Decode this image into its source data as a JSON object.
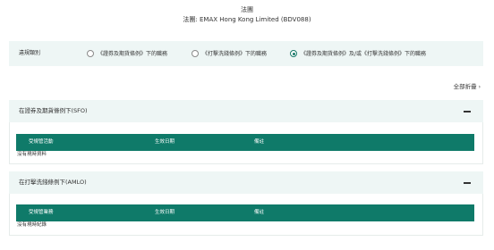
{
  "header": {
    "title": "法團",
    "subtitle": "法團: EMAX Hong Kong Limited (BDV088)"
  },
  "filter": {
    "label": "違規類別",
    "options": [
      {
        "label": "《證券及期貨條例》下的職務",
        "selected": false
      },
      {
        "label": "《打擊洗錢條例》下的職務",
        "selected": false
      },
      {
        "label": "《證券及期貨條例》及/或《打擊洗錢條例》下的職務",
        "selected": true
      }
    ]
  },
  "show_all": {
    "label": "全部折疊",
    "icon": "chevron-right-icon"
  },
  "sections": [
    {
      "title": "在證券及期貨條例下(SFO)",
      "columns": [
        "受規管活動",
        "生效日期",
        "備註"
      ],
      "empty_text": "沒有現時資料",
      "collapse_icon": "minus-icon"
    },
    {
      "title": "在打擊洗錢條例下(AMLO)",
      "columns": [
        "受規管業務",
        "生效日期",
        "備註"
      ],
      "empty_text": "沒有現時紀錄",
      "collapse_icon": "minus-icon"
    }
  ],
  "colors": {
    "accent": "#0f7a69",
    "panel_bg": "#eef6f5",
    "text": "#333333"
  }
}
